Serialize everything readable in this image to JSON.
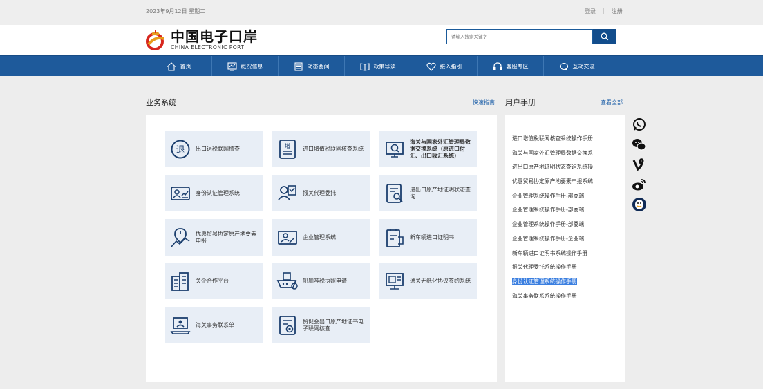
{
  "topbar": {
    "date": "2023年9月12日 星期二",
    "login": "登录",
    "register": "注册"
  },
  "logo": {
    "cn": "中国电子口岸",
    "en": "CHINA ELECTRONIC PORT"
  },
  "search": {
    "placeholder": "请输入搜索关键字"
  },
  "nav": [
    {
      "label": "首页",
      "icon": "home-icon"
    },
    {
      "label": "概况信息",
      "icon": "monitor-icon"
    },
    {
      "label": "动态要闻",
      "icon": "news-icon"
    },
    {
      "label": "政策导读",
      "icon": "book-icon"
    },
    {
      "label": "接入指引",
      "icon": "heart-icon"
    },
    {
      "label": "客服专区",
      "icon": "headset-icon"
    },
    {
      "label": "互动交流",
      "icon": "chat-icon"
    }
  ],
  "business": {
    "title": "业务系统",
    "quick_guide": "快速指南",
    "systems": [
      {
        "label": "出口退税联网稽查",
        "icon": "tax-refund-icon"
      },
      {
        "label": "进口增值税联网核查系统",
        "icon": "vat-icon"
      },
      {
        "label": "海关与国家外汇管理局数据交换系统（原进口付汇、出口收汇系统）",
        "icon": "forex-search-icon"
      },
      {
        "label": "身份认证管理系统",
        "icon": "id-card-icon"
      },
      {
        "label": "报关代理委托",
        "icon": "agent-icon"
      },
      {
        "label": "进出口原产地证明状态查询",
        "icon": "certificate-search-icon"
      },
      {
        "label": "优惠贸易协定原产地要素申报",
        "icon": "location-chart-icon"
      },
      {
        "label": "企业管理系统",
        "icon": "enterprise-icon"
      },
      {
        "label": "新车辆进口证明书",
        "icon": "vehicle-document-icon"
      },
      {
        "label": "关企合作平台",
        "icon": "building-icon"
      },
      {
        "label": "船舶吨税执照申请",
        "icon": "ship-icon"
      },
      {
        "label": "通关无纸化协议签约系统",
        "icon": "paperless-icon"
      },
      {
        "label": "海关事务联系单",
        "icon": "laptop-icon"
      },
      {
        "label": "贸促会出口原产地证书电子联网核查",
        "icon": "origin-check-icon"
      }
    ]
  },
  "manuals": {
    "title": "用户手册",
    "view_all": "查看全部",
    "items": [
      "进口增值税联网核查系统操作手册",
      "海关与国家外汇管理局数据交换系",
      "进出口原产地证明状态查询系统操",
      "优惠贸易协定原产地要素申报系统",
      "企业管理系统操作手册-部委端",
      "企业管理系统操作手册-部委端",
      "企业管理系统操作手册-部委端",
      "企业管理系统操作手册-企业端",
      "新车辆进口证明书系统操作手册",
      "报关代理委托系统操作手册",
      "身份认证管理系统操作手册",
      "海关事务联系系统操作手册"
    ],
    "highlighted_index": 10
  },
  "social": [
    "whatsapp-icon",
    "wechat-icon",
    "vine-icon",
    "weibo-icon",
    "qq-icon"
  ],
  "colors": {
    "nav_bg": "#1e5a9b",
    "accent": "#1d5fa8",
    "card_bg": "#e8eef6",
    "highlight": "#3b7fe0"
  }
}
